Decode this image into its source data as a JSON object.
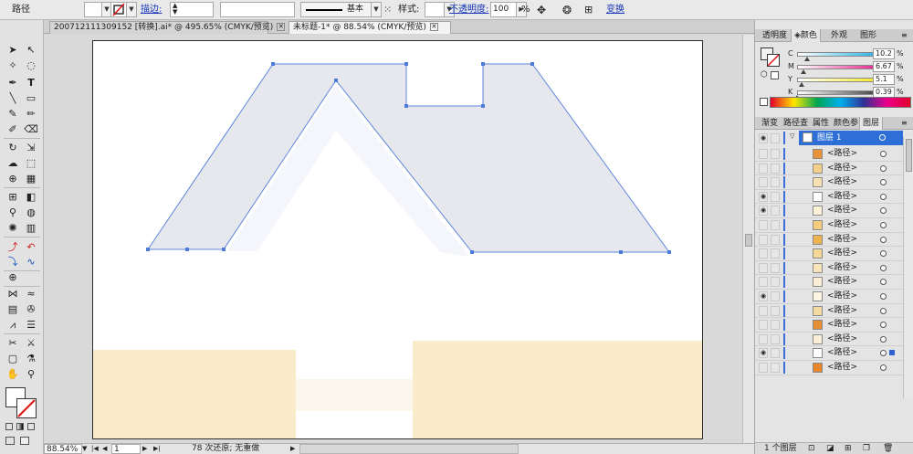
{
  "control_bar": {
    "object_type": "路径",
    "stroke_label": "描边:",
    "stroke_style": "基本",
    "style_label": "样式:",
    "opacity_label": "不透明度:",
    "opacity_value": "100",
    "opacity_unit": "%",
    "transform_label": "变换"
  },
  "tabs": [
    {
      "label": "200712111309152 [转换].ai* @ 495.65% (CMYK/预览)",
      "active": false
    },
    {
      "label": "未标题-1* @ 88.54% (CMYK/预览)",
      "active": true
    }
  ],
  "status_bar": {
    "zoom": "88.54%",
    "page": "1",
    "info": "78 次还原; 无重做"
  },
  "panels": {
    "top_tabs": [
      "透明度",
      "颜色",
      "外观",
      "图形"
    ],
    "top_active": "颜色",
    "color": {
      "channels": [
        {
          "name": "C",
          "value": "10.2",
          "unit": "%",
          "fraction": 0.102,
          "color": "#00a6e0"
        },
        {
          "name": "M",
          "value": "6.67",
          "unit": "%",
          "fraction": 0.0667,
          "color": "#e2007a"
        },
        {
          "name": "Y",
          "value": "5.1",
          "unit": "%",
          "fraction": 0.051,
          "color": "#f2e400"
        },
        {
          "name": "K",
          "value": "0.39",
          "unit": "%",
          "fraction": 0.0039,
          "color": "#222222"
        }
      ]
    },
    "bottom_tabs": [
      "渐变",
      "路径查",
      "属性",
      "颜色参",
      "图层"
    ],
    "bottom_active": "图层",
    "layers": {
      "layer_name": "图层 1",
      "sublayers": [
        {
          "name": "<路径>",
          "visible": false,
          "thumb": "#e8923a"
        },
        {
          "name": "<路径>",
          "visible": false,
          "thumb": "#f3cf89"
        },
        {
          "name": "<路径>",
          "visible": false,
          "thumb": "#f6e1b0"
        },
        {
          "name": "<路径>",
          "visible": true,
          "thumb": "#ffffff"
        },
        {
          "name": "<路径>",
          "visible": true,
          "thumb": "#fdf1d8"
        },
        {
          "name": "<路径>",
          "visible": false,
          "thumb": "#f3cc7f"
        },
        {
          "name": "<路径>",
          "visible": false,
          "thumb": "#eeb34f"
        },
        {
          "name": "<路径>",
          "visible": false,
          "thumb": "#f5d796"
        },
        {
          "name": "<路径>",
          "visible": false,
          "thumb": "#f8e4bb"
        },
        {
          "name": "<路径>",
          "visible": false,
          "thumb": "#fbeed4"
        },
        {
          "name": "<路径>",
          "visible": true,
          "thumb": "#fdf4e2"
        },
        {
          "name": "<路径>",
          "visible": false,
          "thumb": "#f4d9a0"
        },
        {
          "name": "<路径>",
          "visible": false,
          "thumb": "#e58e34"
        },
        {
          "name": "<路径>",
          "visible": false,
          "thumb": "#fcefd9"
        },
        {
          "name": "<路径>",
          "visible": true,
          "thumb": "#ffffff"
        },
        {
          "name": "<路径>",
          "visible": false,
          "thumb": "#e9862c"
        }
      ]
    },
    "layer_count": "1 个图层"
  }
}
